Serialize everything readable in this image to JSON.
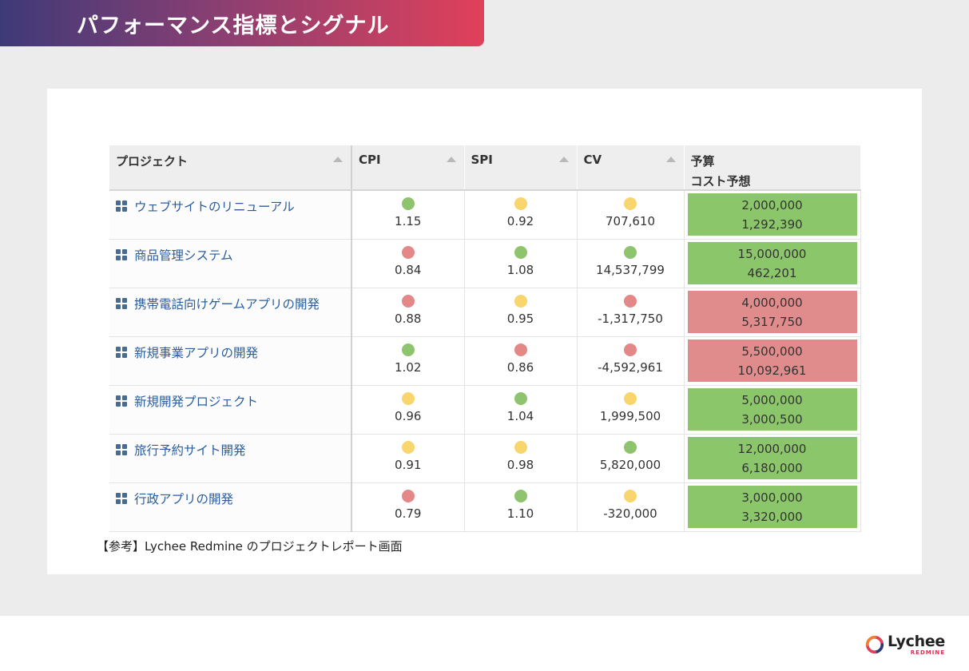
{
  "header": {
    "title": "パフォーマンス指標とシグナル"
  },
  "colors": {
    "green": "#8fc46e",
    "yellow": "#f9d56e",
    "red": "#e38787",
    "budget_green": "#8cc66b",
    "budget_red": "#e08c8c"
  },
  "table": {
    "headers": {
      "project": "プロジェクト",
      "cpi": "CPI",
      "spi": "SPI",
      "cv": "CV",
      "budget_line1": "予算",
      "budget_line2": "コスト予想"
    },
    "rows": [
      {
        "name": "ウェブサイトのリニューアル",
        "cpi": "1.15",
        "cpi_status": "green",
        "spi": "0.92",
        "spi_status": "yellow",
        "cv": "707,610",
        "cv_status": "yellow",
        "budget": "2,000,000",
        "forecast": "1,292,390",
        "budget_status": "green"
      },
      {
        "name": "商品管理システム",
        "cpi": "0.84",
        "cpi_status": "red",
        "spi": "1.08",
        "spi_status": "green",
        "cv": "14,537,799",
        "cv_status": "green",
        "budget": "15,000,000",
        "forecast": "462,201",
        "budget_status": "green"
      },
      {
        "name": "携帯電話向けゲームアプリの開発",
        "cpi": "0.88",
        "cpi_status": "red",
        "spi": "0.95",
        "spi_status": "yellow",
        "cv": "-1,317,750",
        "cv_status": "red",
        "budget": "4,000,000",
        "forecast": "5,317,750",
        "budget_status": "red"
      },
      {
        "name": "新規事業アプリの開発",
        "cpi": "1.02",
        "cpi_status": "green",
        "spi": "0.86",
        "spi_status": "red",
        "cv": "-4,592,961",
        "cv_status": "red",
        "budget": "5,500,000",
        "forecast": "10,092,961",
        "budget_status": "red"
      },
      {
        "name": "新規開発プロジェクト",
        "cpi": "0.96",
        "cpi_status": "yellow",
        "spi": "1.04",
        "spi_status": "green",
        "cv": "1,999,500",
        "cv_status": "yellow",
        "budget": "5,000,000",
        "forecast": "3,000,500",
        "budget_status": "green"
      },
      {
        "name": "旅行予約サイト開発",
        "cpi": "0.91",
        "cpi_status": "yellow",
        "spi": "0.98",
        "spi_status": "yellow",
        "cv": "5,820,000",
        "cv_status": "green",
        "budget": "12,000,000",
        "forecast": "6,180,000",
        "budget_status": "green"
      },
      {
        "name": "行政アプリの開発",
        "cpi": "0.79",
        "cpi_status": "red",
        "spi": "1.10",
        "spi_status": "green",
        "cv": "-320,000",
        "cv_status": "yellow",
        "budget": "3,000,000",
        "forecast": "3,320,000",
        "budget_status": "green"
      }
    ]
  },
  "caption": "【参考】Lychee Redmine のプロジェクトレポート画面",
  "logo": {
    "name": "Lychee",
    "sub": "REDMINE"
  }
}
